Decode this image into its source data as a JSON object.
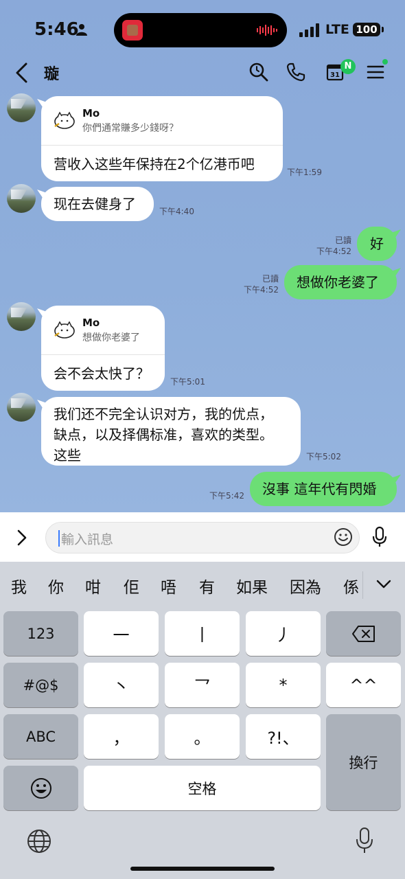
{
  "status_bar": {
    "time": "5:46",
    "network": "LTE",
    "battery": "100"
  },
  "header": {
    "title": "璇",
    "calendar_day": "31",
    "calendar_badge": "N"
  },
  "messages": [
    {
      "side": "in",
      "reply_to": {
        "name": "Mo",
        "text": "你們通常賺多少錢呀？"
      },
      "text": "营收入这些年保持在2个亿港币吧",
      "time": "下午1:59"
    },
    {
      "side": "in",
      "text": "现在去健身了",
      "time": "下午4:40"
    },
    {
      "side": "out",
      "read": "已讀",
      "text": "好",
      "time": "下午4:52"
    },
    {
      "side": "out",
      "read": "已讀",
      "text": "想做你老婆了",
      "time": "下午4:52"
    },
    {
      "side": "in",
      "reply_to": {
        "name": "Mo",
        "text": "想做你老婆了"
      },
      "text": "会不会太快了？",
      "time": "下午5:01"
    },
    {
      "side": "in",
      "lines": [
        "我们还不完全认识对方，我的优点，",
        "缺点，以及择偶标准，喜欢的类型。",
        "这些"
      ],
      "time": "下午5:02"
    },
    {
      "side": "out",
      "text": "沒事 這年代有閃婚",
      "time": "下午5:42"
    }
  ],
  "input": {
    "placeholder": "輸入訊息"
  },
  "keyboard": {
    "suggestions": [
      "我",
      "你",
      "咁",
      "佢",
      "唔",
      "有",
      "如果",
      "因為",
      "係"
    ],
    "keys": {
      "num": "123",
      "sym": "#@$",
      "abc": "ABC",
      "stroke_h": "一",
      "stroke_s": "丨",
      "stroke_p": "丿",
      "stroke_d": "丶",
      "stroke_z": "乛",
      "wild": "*",
      "kaomoji": "^^",
      "comma": "，",
      "period": "。",
      "punct": "?!、",
      "space": "空格",
      "return": "換行"
    }
  },
  "colors": {
    "chat_bg": "#8eadd8",
    "out_bubble": "#6cde75",
    "badge": "#22c35b"
  }
}
